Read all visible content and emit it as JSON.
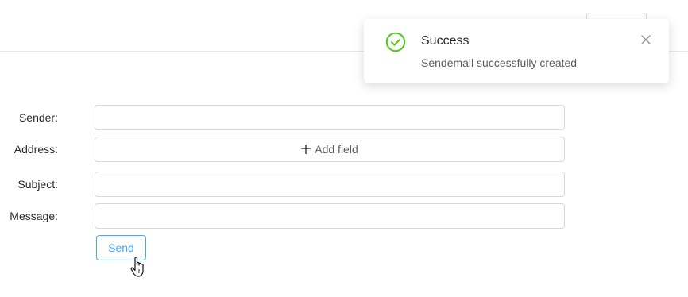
{
  "form": {
    "sender_label": "Sender:",
    "address_label": "Address:",
    "add_field_label": "Add field",
    "subject_label": "Subject:",
    "message_label": "Message:",
    "send_label": "Send",
    "sender_value": "",
    "subject_value": "",
    "message_value": ""
  },
  "notification": {
    "title": "Success",
    "description": "Sendemail successfully created",
    "status_color": "#52c41a"
  },
  "colors": {
    "primary": "#40a9ff",
    "border": "#d9d9d9"
  },
  "icons": {
    "success": "check-circle-icon",
    "close": "close-icon",
    "add": "plus-icon",
    "cursor": "hand-pointer-icon"
  }
}
